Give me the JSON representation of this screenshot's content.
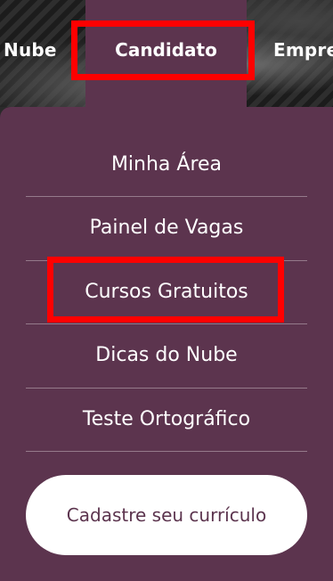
{
  "nav": {
    "left_label": "Nube",
    "active_label": "Candidato",
    "right_label": "Empre"
  },
  "menu": {
    "items": [
      {
        "label": "Minha Área"
      },
      {
        "label": "Painel de Vagas"
      },
      {
        "label": "Cursos Gratuitos"
      },
      {
        "label": "Dicas do Nube"
      },
      {
        "label": "Teste Ortográfico"
      }
    ]
  },
  "cta": {
    "label": "Cadastre seu currículo"
  },
  "colors": {
    "brand": "#5c344e",
    "highlight": "#ff0000",
    "button_bg": "#ffffff"
  }
}
